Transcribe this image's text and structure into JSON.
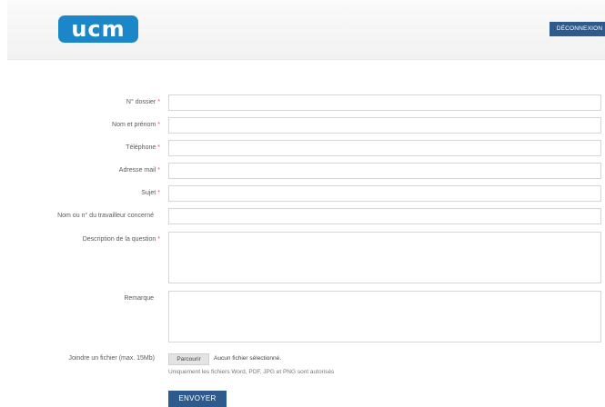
{
  "header": {
    "logo_text": "ucm",
    "logout_label": "DÉCONNEXION"
  },
  "colors": {
    "brand": "#1b87c9",
    "button": "#2d5b8e",
    "required": "#d9534f"
  },
  "form": {
    "fields": [
      {
        "label": "N° dossier",
        "required": "*",
        "value": ""
      },
      {
        "label": "Nom et prénom",
        "required": "*",
        "value": ""
      },
      {
        "label": "Téléphone",
        "required": "*",
        "value": ""
      },
      {
        "label": "Adresse mail",
        "required": "*",
        "value": ""
      },
      {
        "label": "Sujet",
        "required": "*",
        "value": ""
      },
      {
        "label": "Nom ou n° du travailleur concerné",
        "required": "",
        "value": ""
      }
    ],
    "description": {
      "label": "Description de la question",
      "required": "*",
      "value": ""
    },
    "remark": {
      "label": "Remarque",
      "value": ""
    },
    "attachment": {
      "label": "Joindre un fichier (max. 15Mb)",
      "browse_label": "Parcourir",
      "no_file_text": "Aucun fichier sélectionné.",
      "hint": "Uniquement les fichiers Word, PDF, JPG et PNG sont autorisés"
    },
    "submit_label": "ENVOYER"
  }
}
